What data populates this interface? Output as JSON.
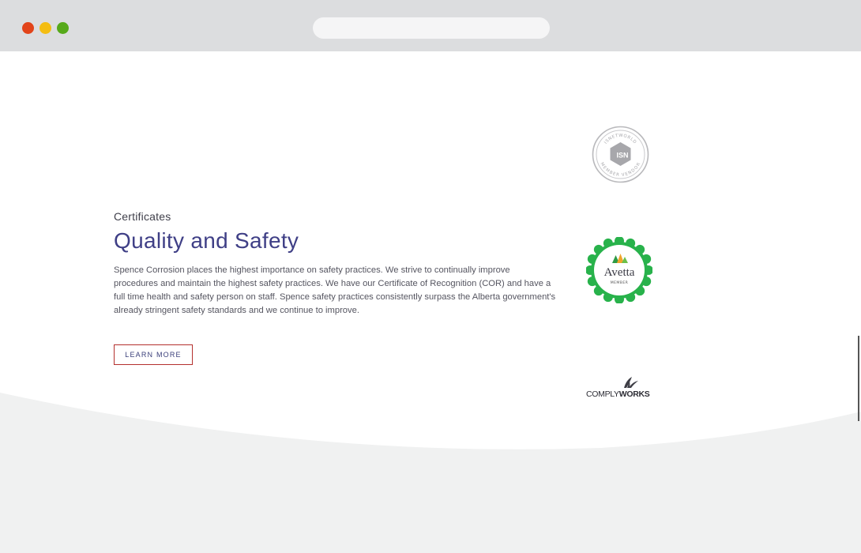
{
  "section": {
    "eyebrow": "Certificates",
    "title": "Quality and Safety",
    "body": "Spence Corrosion places the highest importance on safety practices. We strive to continually improve procedures and maintain the highest safety practices. We have our Certificate of Recognition (COR) and have a full time health and safety person on staff. Spence safety practices consistently surpass the Alberta government's already stringent safety standards and we continue to improve.",
    "button_label": "LEARN MORE"
  },
  "logos": {
    "isn": {
      "top_text": "ISNETWORLD",
      "center_text": "ISN",
      "bottom_text": "MEMBER VENDOR"
    },
    "avetta": {
      "name": "Avetta",
      "sub": "MEMBER"
    },
    "complyworks": {
      "part1": "COMPLY",
      "part2": "WORKS"
    }
  },
  "colors": {
    "title": "#3f3f86",
    "button_border": "#b4302d",
    "avetta_green": "#28b24b",
    "footer_bg": "#f0f1f1"
  }
}
